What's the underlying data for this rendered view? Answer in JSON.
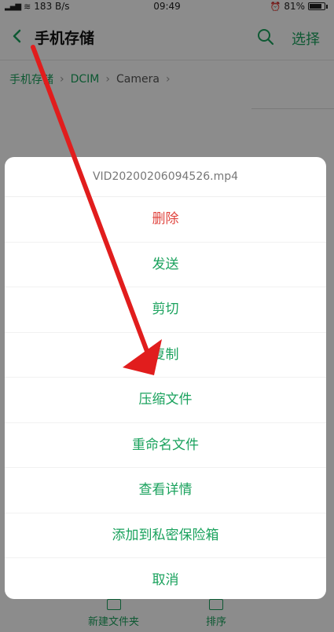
{
  "status_bar": {
    "network": "183 B/s",
    "time": "09:49",
    "battery": "81%"
  },
  "header": {
    "title": "手机存储",
    "select_label": "选择",
    "back_icon": "back-chevron-icon",
    "search_icon": "search-icon"
  },
  "breadcrumb": {
    "items": [
      "手机存储",
      "DCIM",
      "Camera"
    ]
  },
  "bottom_toolbar": {
    "new_folder": "新建文件夹",
    "sort": "排序"
  },
  "sheet": {
    "filename": "VID20200206094526.mp4",
    "items": [
      "删除",
      "发送",
      "剪切",
      "复制",
      "压缩文件",
      "重命名文件",
      "查看详情",
      "添加到私密保险箱",
      "取消"
    ]
  },
  "colors": {
    "accent": "#1aa25d",
    "danger": "#e0443e",
    "annotation": "#e11d1d"
  }
}
